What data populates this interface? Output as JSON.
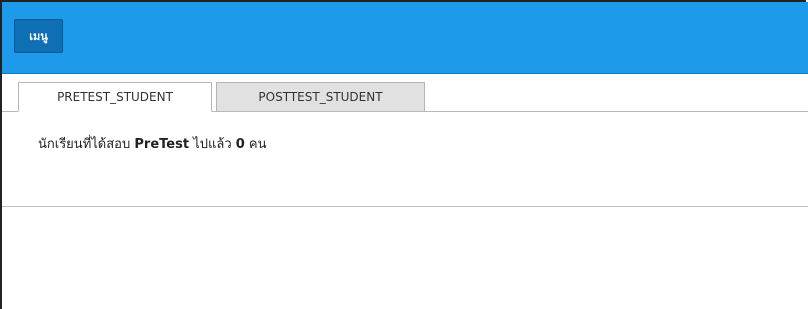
{
  "toolbar": {
    "menu_label": "เมนู",
    "bar_color": "#1d9bea",
    "button_color": "#0e6fb5"
  },
  "tabs": [
    {
      "label": "PRETEST_STUDENT",
      "active": true
    },
    {
      "label": "POSTTEST_STUDENT",
      "active": false
    }
  ],
  "status": {
    "prefix": "นักเรียนที่ได้สอบ ",
    "test_name": "PreTest",
    "middle": " ไปแล้ว ",
    "count": "0",
    "suffix": " คน"
  }
}
